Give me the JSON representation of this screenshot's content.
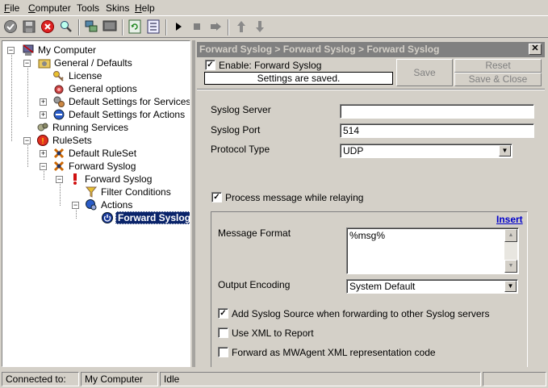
{
  "menu": [
    "File",
    "Computer",
    "Tools",
    "Skins",
    "Help"
  ],
  "toolbar": {
    "buttons": [
      "ok-icon",
      "save-icon",
      "stop-icon",
      "search-icon",
      "network-icon",
      "monitor-icon",
      "refresh-icon",
      "config-icon",
      "play-icon",
      "stop-square-icon",
      "step-icon",
      "arrow-up-icon",
      "arrow-down-icon"
    ]
  },
  "tree": {
    "my_computer": "My Computer",
    "general_defaults": "General / Defaults",
    "license": "License",
    "general_options": "General options",
    "default_settings_services": "Default Settings for Services",
    "default_settings_actions": "Default Settings for Actions",
    "running_services": "Running Services",
    "rulesets": "RuleSets",
    "default_ruleset": "Default RuleSet",
    "forward_syslog_ruleset": "Forward Syslog",
    "forward_syslog_rule": "Forward Syslog",
    "filter_conditions": "Filter Conditions",
    "actions": "Actions",
    "forward_syslog_action": "Forward Syslog"
  },
  "panel": {
    "title": "Forward Syslog > Forward Syslog > Forward Syslog",
    "close": "✕",
    "enable_label": "Enable: Forward Syslog",
    "enable_checked": true,
    "status": "Settings are saved.",
    "save": "Save",
    "reset": "Reset",
    "save_close": "Save & Close"
  },
  "form": {
    "syslog_server_label": "Syslog Server",
    "syslog_server_value": "",
    "syslog_port_label": "Syslog Port",
    "syslog_port_value": "514",
    "protocol_type_label": "Protocol Type",
    "protocol_type_value": "UDP",
    "process_relay_label": "Process message while relaying",
    "process_relay_checked": true,
    "insert_link": "Insert",
    "message_format_label": "Message Format",
    "message_format_value": "%msg%",
    "output_encoding_label": "Output Encoding",
    "output_encoding_value": "System Default",
    "add_source_label": "Add Syslog Source when forwarding to other Syslog servers",
    "add_source_checked": true,
    "use_xml_label": "Use XML to Report",
    "use_xml_checked": false,
    "forward_mwagent_label": "Forward as MWAgent XML representation code",
    "forward_mwagent_checked": false
  },
  "statusbar": {
    "connected_label": "Connected to:",
    "computer": "My Computer",
    "state": "Idle"
  },
  "colors": {
    "face": "#d4d0c8",
    "selection": "#0a246a",
    "title_bar": "#808080",
    "link": "#0000cc"
  }
}
